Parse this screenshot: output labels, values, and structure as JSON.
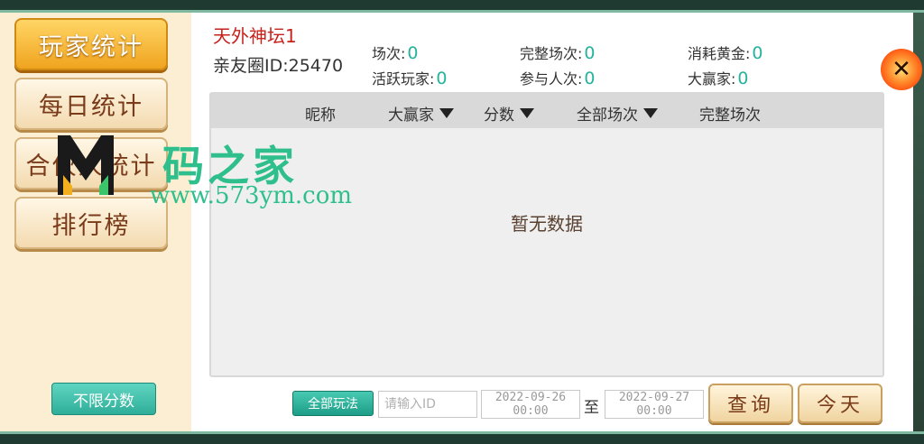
{
  "sidebar": {
    "items": [
      {
        "label": "玩家统计",
        "active": true
      },
      {
        "label": "每日统计",
        "active": false
      },
      {
        "label": "合伙人统计",
        "active": false
      },
      {
        "label": "排行榜",
        "active": false
      }
    ],
    "unlimited_score_label": "不限分数"
  },
  "header": {
    "club_name": "天外神坛1",
    "club_id": "亲友圈ID:25470"
  },
  "stats": {
    "games": {
      "label": "场次:",
      "value": "0"
    },
    "complete_games": {
      "label": "完整场次:",
      "value": "0"
    },
    "gold_consumed": {
      "label": "消耗黄金:",
      "value": "0"
    },
    "active_players": {
      "label": "活跃玩家:",
      "value": "0"
    },
    "participants": {
      "label": "参与人次:",
      "value": "0"
    },
    "big_winner": {
      "label": "大赢家:",
      "value": "0"
    }
  },
  "table": {
    "columns": [
      "昵称",
      "大赢家",
      "分数",
      "全部场次",
      "完整场次"
    ],
    "empty_text": "暂无数据"
  },
  "filters": {
    "mode_label": "全部玩法",
    "id_placeholder": "请输入ID",
    "start_date": "2022-09-26",
    "start_time": "00:00",
    "to_label": "至",
    "end_date": "2022-09-27",
    "end_time": "00:00",
    "query_label": "查询",
    "today_label": "今天"
  },
  "watermark": {
    "text": "码之家",
    "url": "www.573ym.com"
  },
  "colors": {
    "accent_teal": "#24b39c",
    "active_orange": "#f0a41f",
    "club_name_red": "#c8221d"
  },
  "icons": {
    "close": "close-icon",
    "sort": "sort-down-triangle-icon"
  }
}
